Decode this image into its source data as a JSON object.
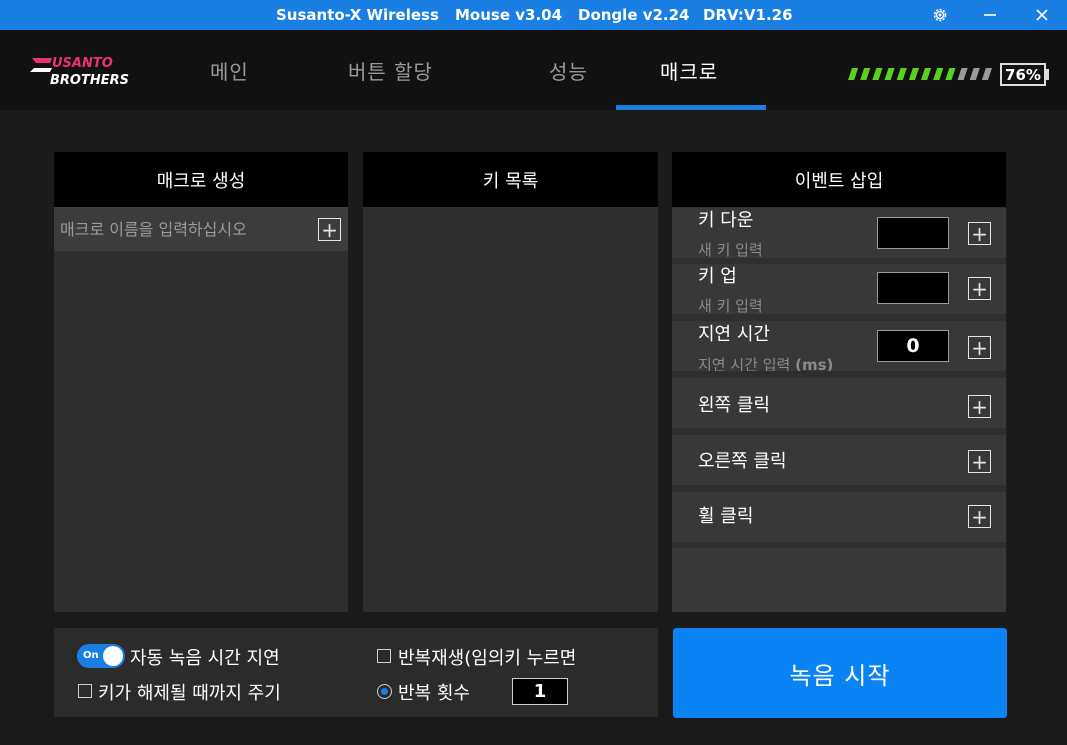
{
  "titlebar": {
    "app_name": "Susanto-X Wireless",
    "mouse_version": "Mouse v3.04",
    "dongle_version": "Dongle v2.24",
    "driver_version": "DRV:V1.26",
    "icons": [
      "gear-icon",
      "minimize-icon",
      "close-icon"
    ]
  },
  "logo": {
    "line1": "SUSANTO",
    "line2": "BROTHERS",
    "accent_color": "#e8336f"
  },
  "tabs": [
    {
      "label": "메인",
      "active": false
    },
    {
      "label": "버튼 할당",
      "active": false
    },
    {
      "label": "성능",
      "active": false
    },
    {
      "label": "매크로",
      "active": true
    }
  ],
  "battery": {
    "percent_label": "76%",
    "level": 0.76,
    "bar_color": "#5ad11e",
    "empty_color": "#9a9a9a"
  },
  "macro_create": {
    "header": "매크로 생성",
    "name_placeholder": "매크로 이름을 입력하십시오",
    "add_symbol": "+"
  },
  "key_list": {
    "header": "키 목록"
  },
  "event_insert": {
    "header": "이벤트 삽입",
    "rows": [
      {
        "title": "키 다운",
        "subtitle": "새 키 입력",
        "value": "",
        "add_symbol": "+"
      },
      {
        "title": "키 업",
        "subtitle": "새 키 입력",
        "value": "",
        "add_symbol": "+"
      },
      {
        "title": "지연 시간",
        "subtitle": "지연 시간 입력",
        "unit": "(ms)",
        "value": "0",
        "add_symbol": "+"
      },
      {
        "title": "왼쪽 클릭",
        "add_symbol": "+"
      },
      {
        "title": "오른쪽 클릭",
        "add_symbol": "+"
      },
      {
        "title": "휠 클릭",
        "add_symbol": "+"
      }
    ]
  },
  "options": {
    "auto_delay": {
      "label": "자동 녹음 시간 지연",
      "toggle_label": "On",
      "on": true
    },
    "until_release": {
      "label": "키가 해제될 때까지 주기",
      "checked": false
    },
    "repeat_any_key": {
      "label": "반복재생(임의키 누르면",
      "checked": false
    },
    "repeat_count": {
      "label": "반복 횟수",
      "selected": true,
      "value": "1"
    }
  },
  "record_button": {
    "label": "녹음 시작"
  },
  "colors": {
    "accent": "#1a7fe3",
    "record": "#0a84f5"
  }
}
